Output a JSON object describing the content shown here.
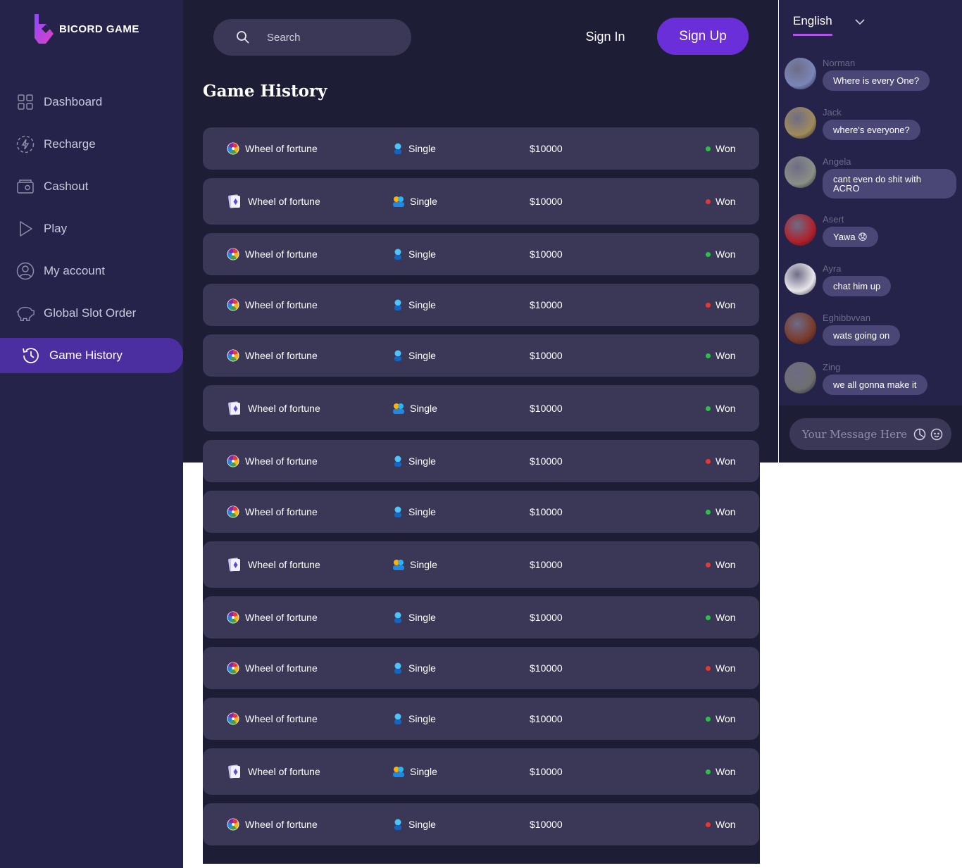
{
  "brand": {
    "name": "BICORD GAME",
    "accent": "#6a2fd8"
  },
  "sidebar": {
    "items": [
      {
        "label": "Dashboard",
        "icon": "grid-icon",
        "active": false
      },
      {
        "label": "Recharge",
        "icon": "lightning-icon",
        "active": false
      },
      {
        "label": "Cashout",
        "icon": "wallet-icon",
        "active": false
      },
      {
        "label": "Play",
        "icon": "play-icon",
        "active": false
      },
      {
        "label": "My account",
        "icon": "user-icon",
        "active": false
      },
      {
        "label": "Global Slot Order",
        "icon": "piggy-bank-icon",
        "active": false
      },
      {
        "label": "Game History",
        "icon": "history-icon",
        "active": true
      }
    ]
  },
  "header": {
    "search_placeholder": "Search",
    "sign_in": "Sign In",
    "sign_up": "Sign Up"
  },
  "main": {
    "title": "Game History",
    "rows": [
      {
        "game": "Wheel of fortune",
        "game_icon": "wheel-icon",
        "type": "Single",
        "amount": "$10000",
        "status": "Won",
        "status_color": "#2fbf4a",
        "tall": false
      },
      {
        "game": "Wheel of fortune",
        "game_icon": "cards-icon",
        "type": "Single",
        "amount": "$10000",
        "status": "Won",
        "status_color": "#e53935",
        "tall": true
      },
      {
        "game": "Wheel of fortune",
        "game_icon": "wheel-icon",
        "type": "Single",
        "amount": "$10000",
        "status": "Won",
        "status_color": "#2fbf4a",
        "tall": false
      },
      {
        "game": "Wheel of fortune",
        "game_icon": "wheel-icon",
        "type": "Single",
        "amount": "$10000",
        "status": "Won",
        "status_color": "#e53935",
        "tall": false
      },
      {
        "game": "Wheel of fortune",
        "game_icon": "wheel-icon",
        "type": "Single",
        "amount": "$10000",
        "status": "Won",
        "status_color": "#2fbf4a",
        "tall": false
      },
      {
        "game": "Wheel of fortune",
        "game_icon": "cards-icon",
        "type": "Single",
        "amount": "$10000",
        "status": "Won",
        "status_color": "#2fbf4a",
        "tall": true
      },
      {
        "game": "Wheel of fortune",
        "game_icon": "wheel-icon",
        "type": "Single",
        "amount": "$10000",
        "status": "Won",
        "status_color": "#e53935",
        "tall": false
      },
      {
        "game": "Wheel of fortune",
        "game_icon": "wheel-icon",
        "type": "Single",
        "amount": "$10000",
        "status": "Won",
        "status_color": "#2fbf4a",
        "tall": false
      },
      {
        "game": "Wheel of fortune",
        "game_icon": "cards-icon",
        "type": "Single",
        "amount": "$10000",
        "status": "Won",
        "status_color": "#e53935",
        "tall": true
      },
      {
        "game": "Wheel of fortune",
        "game_icon": "wheel-icon",
        "type": "Single",
        "amount": "$10000",
        "status": "Won",
        "status_color": "#2fbf4a",
        "tall": false
      },
      {
        "game": "Wheel of fortune",
        "game_icon": "wheel-icon",
        "type": "Single",
        "amount": "$10000",
        "status": "Won",
        "status_color": "#e53935",
        "tall": false
      },
      {
        "game": "Wheel of fortune",
        "game_icon": "wheel-icon",
        "type": "Single",
        "amount": "$10000",
        "status": "Won",
        "status_color": "#2fbf4a",
        "tall": false
      },
      {
        "game": "Wheel of fortune",
        "game_icon": "cards-icon",
        "type": "Single",
        "amount": "$10000",
        "status": "Won",
        "status_color": "#2fbf4a",
        "tall": true
      },
      {
        "game": "Wheel of fortune",
        "game_icon": "wheel-icon",
        "type": "Single",
        "amount": "$10000",
        "status": "Won",
        "status_color": "#e53935",
        "tall": false
      }
    ]
  },
  "chat": {
    "language": "English",
    "messages": [
      {
        "user": "Norman",
        "text": "Where is every One?",
        "avatar_color": "#7a86b8"
      },
      {
        "user": "Jack",
        "text": "where's everyone?",
        "avatar_color": "#a08a5a"
      },
      {
        "user": "Angela",
        "text": "cant even do shit with ACRO",
        "avatar_color": "#8a8f86"
      },
      {
        "user": "Asert",
        "text": "Yawa 😟",
        "avatar_color": "#b0202a"
      },
      {
        "user": "Ayra",
        "text": "chat him up",
        "avatar_color": "#e8e6ea"
      },
      {
        "user": "Eghibbvvan",
        "text": "wats going on",
        "avatar_color": "#7a3a2a"
      },
      {
        "user": "Zing",
        "text": "we all gonna make it",
        "avatar_color": "#6e6e70"
      }
    ],
    "input_placeholder": "Your Message Here"
  }
}
